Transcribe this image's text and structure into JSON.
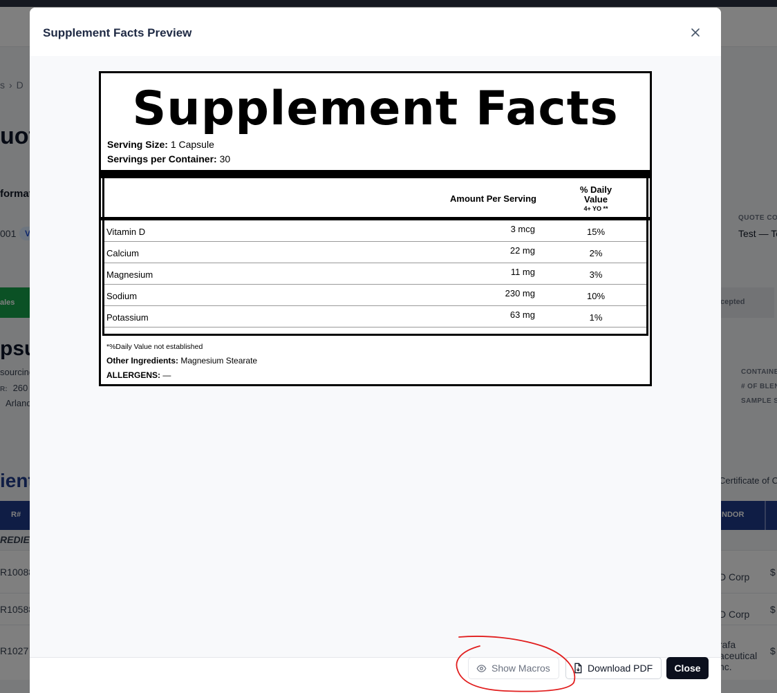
{
  "background": {
    "breadcrumb": [
      "s",
      "D"
    ],
    "page_title_fragment": "uot",
    "section_fragment": "format",
    "id_fragment": "001",
    "pill_fragment": "V",
    "quote_label_fragment": "QUOTE CO",
    "quote_value_fragment": "Test — Te",
    "status_left_fragment": "ales",
    "status_right_fragment": "cepted",
    "product_fragment": "psu",
    "sourcing_fragment": "sourcing",
    "r260_label": "R:",
    "r260_value": "260",
    "arland_fragment": "Arland",
    "right_labels": [
      "CONTAINE",
      "# OF BLEN",
      "SAMPLE S"
    ],
    "ingredients_fragment": "ient",
    "cert_fragment": "Certificate of C",
    "table_header_r": "R#",
    "table_header_vendor": "NDOR",
    "ingredient_group_fragment": "REDIE",
    "rows": [
      {
        "id": "R10088",
        "vendor": "D Corp",
        "price": "$"
      },
      {
        "id": "R10588",
        "vendor": "D Corp",
        "price": "$"
      },
      {
        "id": "R1027",
        "vendor": "rafa\naceutical\nnc.",
        "price": "$"
      }
    ]
  },
  "modal": {
    "title": "Supplement Facts Preview",
    "close_icon": "x-icon"
  },
  "label": {
    "heading": "Supplement Facts",
    "serving_size_label": "Serving Size:",
    "serving_size_value": "1 Capsule",
    "servings_per_container_label": "Servings per Container:",
    "servings_per_container_value": "30",
    "col_amount": "Amount Per Serving",
    "col_dv_line1": "% Daily",
    "col_dv_line2": "Value",
    "col_dv_sub": "4+ YO **",
    "nutrients": [
      {
        "name": "Vitamin D",
        "amount": "3 mcg",
        "dv": "15%"
      },
      {
        "name": "Calcium",
        "amount": "22 mg",
        "dv": "2%"
      },
      {
        "name": "Magnesium",
        "amount": "11 mg",
        "dv": "3%"
      },
      {
        "name": "Sodium",
        "amount": "230 mg",
        "dv": "10%"
      },
      {
        "name": "Potassium",
        "amount": "63 mg",
        "dv": "1%"
      }
    ],
    "dv_note": "*%Daily Value not established",
    "other_ingredients_label": "Other Ingredients:",
    "other_ingredients_value": "Magnesium Stearate",
    "allergens_label": "ALLERGENS:",
    "allergens_value": "—"
  },
  "footer": {
    "show_macros_label": "Show Macros",
    "download_pdf_label": "Download PDF",
    "close_label": "Close"
  },
  "colors": {
    "modal_title": "#1f2a44",
    "close_button": "#0b0f1c",
    "annotation": "#e11d1d"
  }
}
